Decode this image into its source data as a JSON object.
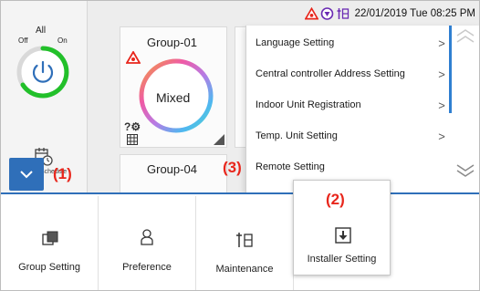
{
  "status_bar": {
    "datetime": "22/01/2019 Tue 08:25 PM",
    "icons": [
      "alarm-warning-icon",
      "filter-sign-icon",
      "maintenance-icon"
    ]
  },
  "all_panel": {
    "title": "All",
    "off_label": "Off",
    "on_label": "On",
    "schedule_label": "Schedule"
  },
  "groups": [
    {
      "name": "Group-01",
      "mode": "Mixed",
      "badges": [
        "alarm-warning-icon",
        "unknown-gear-icon",
        "grid-icon"
      ]
    },
    {
      "name": "Group-04",
      "mode": ""
    }
  ],
  "menu": {
    "items": [
      {
        "label": "Language Setting",
        "arrow": ">"
      },
      {
        "label": "Central controller Address Setting",
        "arrow": ">"
      },
      {
        "label": "Indoor Unit Registration",
        "arrow": ">"
      },
      {
        "label": "Temp. Unit Setting",
        "arrow": ">"
      },
      {
        "label": "Remote Setting",
        "arrow": ""
      }
    ]
  },
  "annotations": {
    "step1": "(1)",
    "step2": "(2)",
    "step3": "(3)"
  },
  "bottom_tabs": [
    {
      "label": "Group Setting",
      "icon": "group-setting-icon"
    },
    {
      "label": "Preference",
      "icon": "preference-icon"
    },
    {
      "label": "Maintenance",
      "icon": "maintenance-icon"
    },
    {
      "label": "Installer Setting",
      "icon": "installer-setting-icon",
      "selected": true
    }
  ],
  "colors": {
    "accent": "#2f6fb9",
    "annotation": "#e8261c",
    "power_on": "#22c02a"
  }
}
